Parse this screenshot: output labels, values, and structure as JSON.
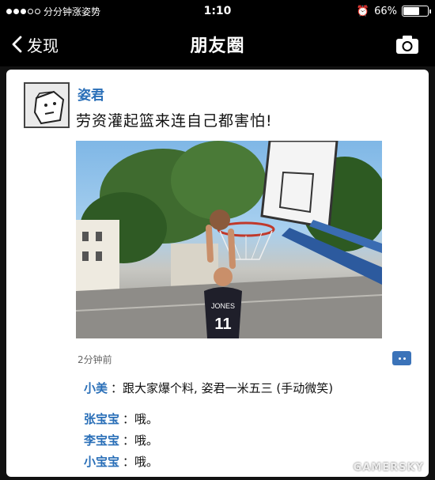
{
  "status_bar": {
    "carrier": "分分钟涨姿势",
    "time": "1:10",
    "battery": "66%",
    "battery_level": 0.66,
    "signal_strength": 3
  },
  "nav": {
    "back_label": "发现",
    "title": "朋友圈",
    "camera_icon": "camera-icon"
  },
  "post": {
    "author": "姿君",
    "text": "劳资灌起篮来连自己都害怕!",
    "timestamp": "2分钟前",
    "photo_subject": "basketball-dunk-photo",
    "jersey_text": "JONES",
    "jersey_number": "11"
  },
  "comments": [
    {
      "name": "小美",
      "text": "跟大家爆个料, 姿君一米五三 (手动微笑)"
    },
    {
      "name": "张宝宝",
      "text": "哦。"
    },
    {
      "name": "李宝宝",
      "text": "哦。"
    },
    {
      "name": "小宝宝",
      "text": "哦。"
    }
  ],
  "comment_separator": "：",
  "watermark": "GAMERSKY",
  "colors": {
    "link_blue": "#2a6fb8",
    "bar_black": "#000000",
    "card_white": "#ffffff"
  }
}
